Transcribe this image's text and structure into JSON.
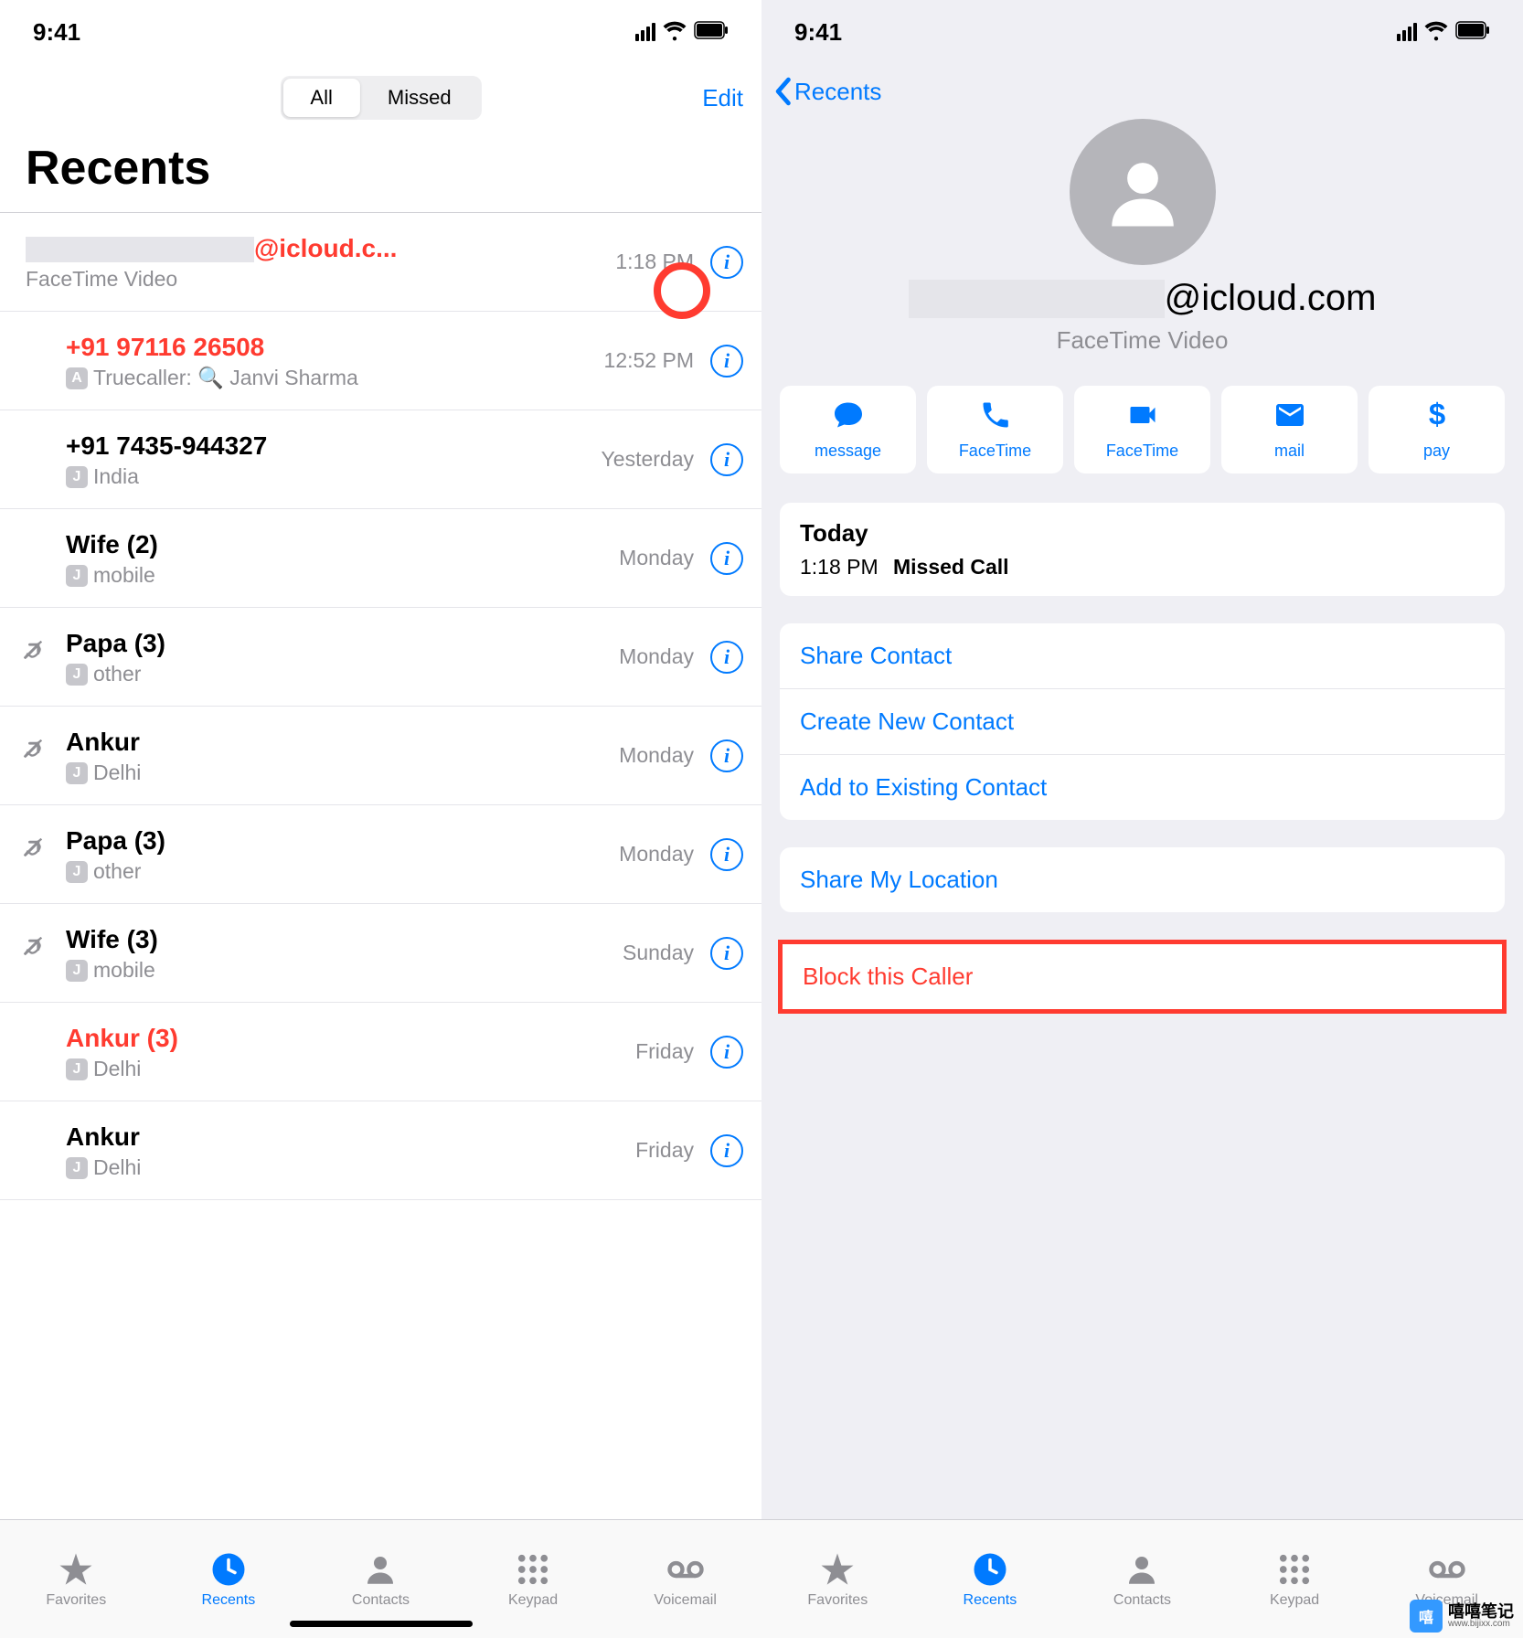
{
  "status": {
    "time": "9:41"
  },
  "left": {
    "segments": {
      "all": "All",
      "missed": "Missed"
    },
    "edit": "Edit",
    "title": "Recents",
    "calls": [
      {
        "name_suffix": "@icloud.c...",
        "sub": "FaceTime Video",
        "time": "1:18 PM",
        "missed": true,
        "outgoing": false,
        "redacted_name": true,
        "badge": ""
      },
      {
        "name": "+91 97116 26508",
        "sub": "Truecaller: 🔍 Janvi Sharma",
        "time": "12:52 PM",
        "missed": true,
        "outgoing": false,
        "badge": "A"
      },
      {
        "name": "+91 7435-944327",
        "sub": "India",
        "time": "Yesterday",
        "missed": false,
        "outgoing": false,
        "badge": "J"
      },
      {
        "name": "Wife (2)",
        "sub": "mobile",
        "time": "Monday",
        "missed": false,
        "outgoing": false,
        "badge": "J"
      },
      {
        "name": "Papa (3)",
        "sub": "other",
        "time": "Monday",
        "missed": false,
        "outgoing": true,
        "badge": "J"
      },
      {
        "name": "Ankur",
        "sub": "Delhi",
        "time": "Monday",
        "missed": false,
        "outgoing": true,
        "badge": "J"
      },
      {
        "name": "Papa (3)",
        "sub": "other",
        "time": "Monday",
        "missed": false,
        "outgoing": true,
        "badge": "J"
      },
      {
        "name": "Wife (3)",
        "sub": "mobile",
        "time": "Sunday",
        "missed": false,
        "outgoing": true,
        "badge": "J"
      },
      {
        "name": "Ankur (3)",
        "sub": "Delhi",
        "time": "Friday",
        "missed": true,
        "outgoing": false,
        "badge": "J"
      },
      {
        "name": "Ankur",
        "sub": "Delhi",
        "time": "Friday",
        "missed": false,
        "outgoing": false,
        "badge": "J"
      }
    ]
  },
  "right": {
    "back": "Recents",
    "contact_suffix": "@icloud.com",
    "contact_sub": "FaceTime Video",
    "actions": [
      {
        "label": "message",
        "icon": "message"
      },
      {
        "label": "FaceTime",
        "icon": "phone"
      },
      {
        "label": "FaceTime",
        "icon": "video"
      },
      {
        "label": "mail",
        "icon": "mail"
      },
      {
        "label": "pay",
        "icon": "dollar"
      }
    ],
    "today_heading": "Today",
    "today_time": "1:18 PM",
    "today_event": "Missed Call",
    "links1": [
      "Share Contact",
      "Create New Contact",
      "Add to Existing Contact"
    ],
    "links2": [
      "Share My Location"
    ],
    "block": "Block this Caller"
  },
  "tabs": [
    {
      "label": "Favorites",
      "icon": "star"
    },
    {
      "label": "Recents",
      "icon": "clock"
    },
    {
      "label": "Contacts",
      "icon": "person"
    },
    {
      "label": "Keypad",
      "icon": "keypad"
    },
    {
      "label": "Voicemail",
      "icon": "voicemail"
    }
  ],
  "watermark": {
    "cn": "嘻嘻笔记",
    "url": "www.bijixx.com"
  }
}
